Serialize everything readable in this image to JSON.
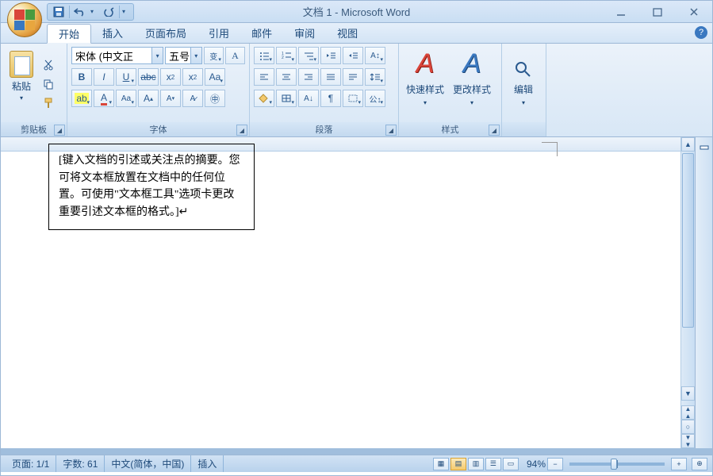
{
  "title": "文档 1 - Microsoft Word",
  "tabs": [
    "开始",
    "插入",
    "页面布局",
    "引用",
    "邮件",
    "审阅",
    "视图"
  ],
  "active_tab": 0,
  "groups": {
    "clipboard": {
      "label": "剪贴板",
      "paste": "粘贴"
    },
    "font": {
      "label": "字体",
      "name": "宋体 (中文正",
      "size": "五号"
    },
    "paragraph": {
      "label": "段落"
    },
    "styles": {
      "label": "样式",
      "quick": "快速样式",
      "change": "更改样式"
    },
    "editing": {
      "label": "编辑"
    }
  },
  "textbox_content": "[键入文档的引述或关注点的摘要。您可将文本框放置在文档中的任何位置。可使用\"文本框工具\"选项卡更改重要引述文本框的格式。]↵",
  "status": {
    "page": "页面: 1/1",
    "words": "字数: 61",
    "lang": "中文(简体，中国)",
    "mode": "插入",
    "zoom": "94%"
  },
  "icons": {
    "help": "?"
  }
}
